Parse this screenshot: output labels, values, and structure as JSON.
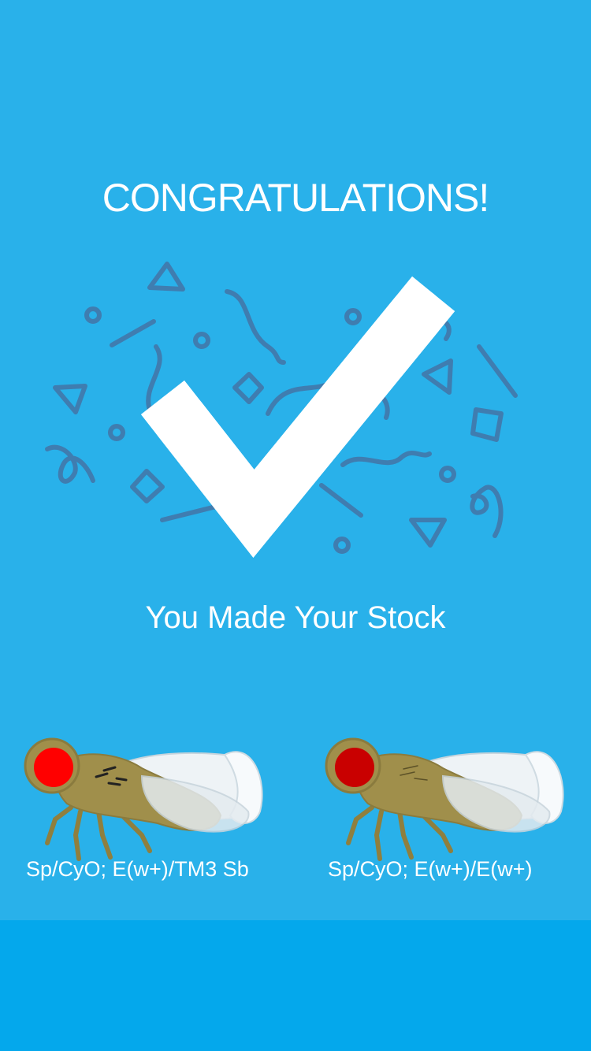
{
  "screen": {
    "title": "CONGRATULATIONS!",
    "subtitle": "You Made Your Stock"
  },
  "icons": {
    "check": "checkmark-icon",
    "confetti": "confetti-decoration"
  },
  "flies": [
    {
      "genotype": "Sp/CyO; E(w+)/TM3 Sb",
      "eye_color": "#ff0000",
      "image": "fly-illustration"
    },
    {
      "genotype": "Sp/CyO; E(w+)/E(w+)",
      "eye_color": "#c90000",
      "image": "fly-illustration"
    }
  ],
  "colors": {
    "background": "#29b1ea",
    "footer": "#04a8ec",
    "confetti": "#3f7db0",
    "fly_body": "#a08f4b"
  }
}
